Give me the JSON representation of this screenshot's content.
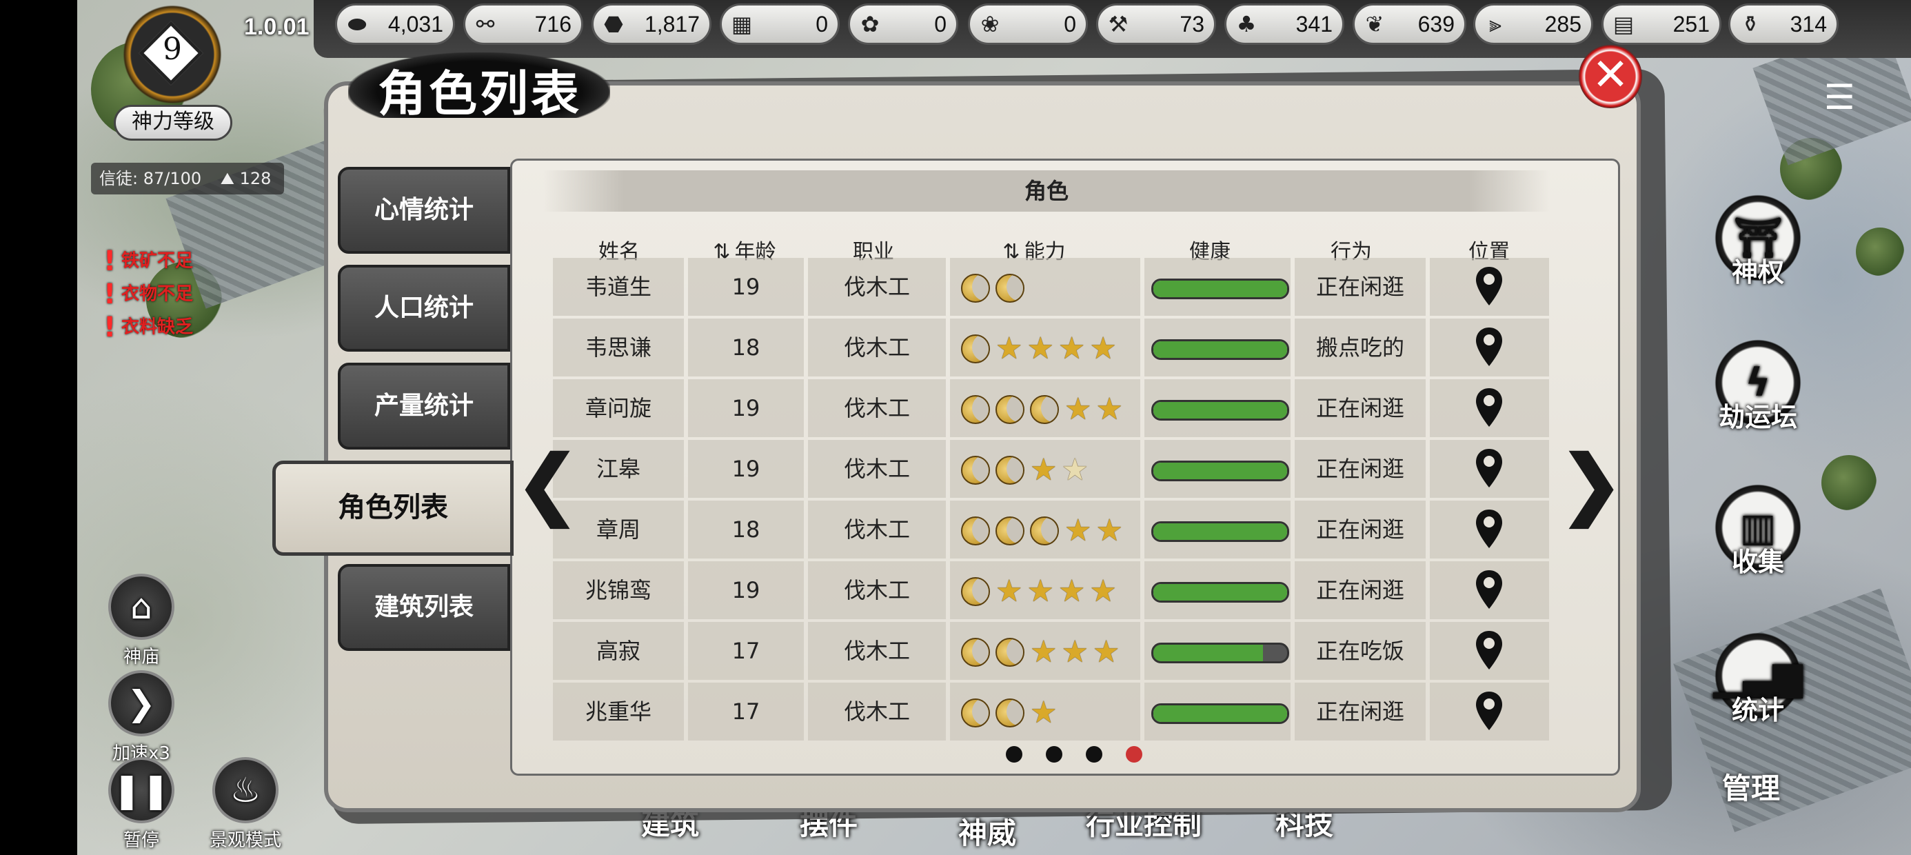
{
  "app": {
    "version": "1.0.01",
    "god_level": "9",
    "god_level_label": "神力等级"
  },
  "followers": {
    "text": "信徒: 87/100",
    "prayer": "128"
  },
  "resources": [
    {
      "icon": "stone-icon",
      "value": "4,031"
    },
    {
      "icon": "wood-icon",
      "value": "716"
    },
    {
      "icon": "ore-icon",
      "value": "1,817"
    },
    {
      "icon": "brick-icon",
      "value": "0"
    },
    {
      "icon": "flower-icon",
      "value": "0"
    },
    {
      "icon": "cloth-icon",
      "value": "0"
    },
    {
      "icon": "hammer-icon",
      "value": "73"
    },
    {
      "icon": "herb-icon",
      "value": "341"
    },
    {
      "icon": "leaf-icon",
      "value": "639"
    },
    {
      "icon": "grain-icon",
      "value": "285"
    },
    {
      "icon": "furniture-icon",
      "value": "251"
    },
    {
      "icon": "wine-icon",
      "value": "314"
    }
  ],
  "warnings": [
    "铁矿不足",
    "衣物不足",
    "衣料缺乏"
  ],
  "left_controls": {
    "temple": "神庙",
    "speed": "加速x3",
    "pause": "暂停",
    "scenic": "景观模式"
  },
  "right_buttons": {
    "divine": "神权",
    "altar": "劫运坛",
    "collect": "收集",
    "stats": "统计",
    "manage": "管理"
  },
  "bottom_nav": [
    "建筑",
    "摆件",
    "神威",
    "行业控制",
    "科技"
  ],
  "panel": {
    "title": "角色列表",
    "tabs": [
      "心情统计",
      "人口统计",
      "产量统计",
      "角色列表",
      "建筑列表"
    ],
    "active_tab": "角色列表",
    "section_header": "角色",
    "columns": {
      "name": "姓名",
      "age": "年龄",
      "job": "职业",
      "ability": "能力",
      "health": "健康",
      "action": "行为",
      "location": "位置"
    },
    "nav": {
      "prev": "❮",
      "next": "❯"
    },
    "page_count": 4,
    "current_page": 4
  },
  "characters": [
    {
      "name": "韦道生",
      "age": "19",
      "job": "伐木工",
      "moons": 2,
      "stars": 0,
      "pale_stars": 0,
      "health": 1.0,
      "action": "正在闲逛"
    },
    {
      "name": "韦思谦",
      "age": "18",
      "job": "伐木工",
      "moons": 1,
      "stars": 4,
      "pale_stars": 0,
      "health": 1.0,
      "action": "搬点吃的"
    },
    {
      "name": "章问旋",
      "age": "19",
      "job": "伐木工",
      "moons": 3,
      "stars": 2,
      "pale_stars": 0,
      "health": 1.0,
      "action": "正在闲逛"
    },
    {
      "name": "江皋",
      "age": "19",
      "job": "伐木工",
      "moons": 2,
      "stars": 1,
      "pale_stars": 1,
      "health": 1.0,
      "action": "正在闲逛"
    },
    {
      "name": "章周",
      "age": "18",
      "job": "伐木工",
      "moons": 3,
      "stars": 2,
      "pale_stars": 0,
      "health": 1.0,
      "action": "正在闲逛"
    },
    {
      "name": "兆锦鸾",
      "age": "19",
      "job": "伐木工",
      "moons": 1,
      "stars": 4,
      "pale_stars": 0,
      "health": 1.0,
      "action": "正在闲逛"
    },
    {
      "name": "高寂",
      "age": "17",
      "job": "伐木工",
      "moons": 2,
      "stars": 3,
      "pale_stars": 0,
      "health": 0.82,
      "action": "正在吃饭"
    },
    {
      "name": "兆重华",
      "age": "17",
      "job": "伐木工",
      "moons": 2,
      "stars": 1,
      "pale_stars": 0,
      "health": 1.0,
      "action": "正在闲逛"
    }
  ],
  "colors": {
    "health_fill": "#4fa23a",
    "active_page_dot": "#cc3333",
    "close_button": "#d33333",
    "warning_text": "#e02020"
  }
}
